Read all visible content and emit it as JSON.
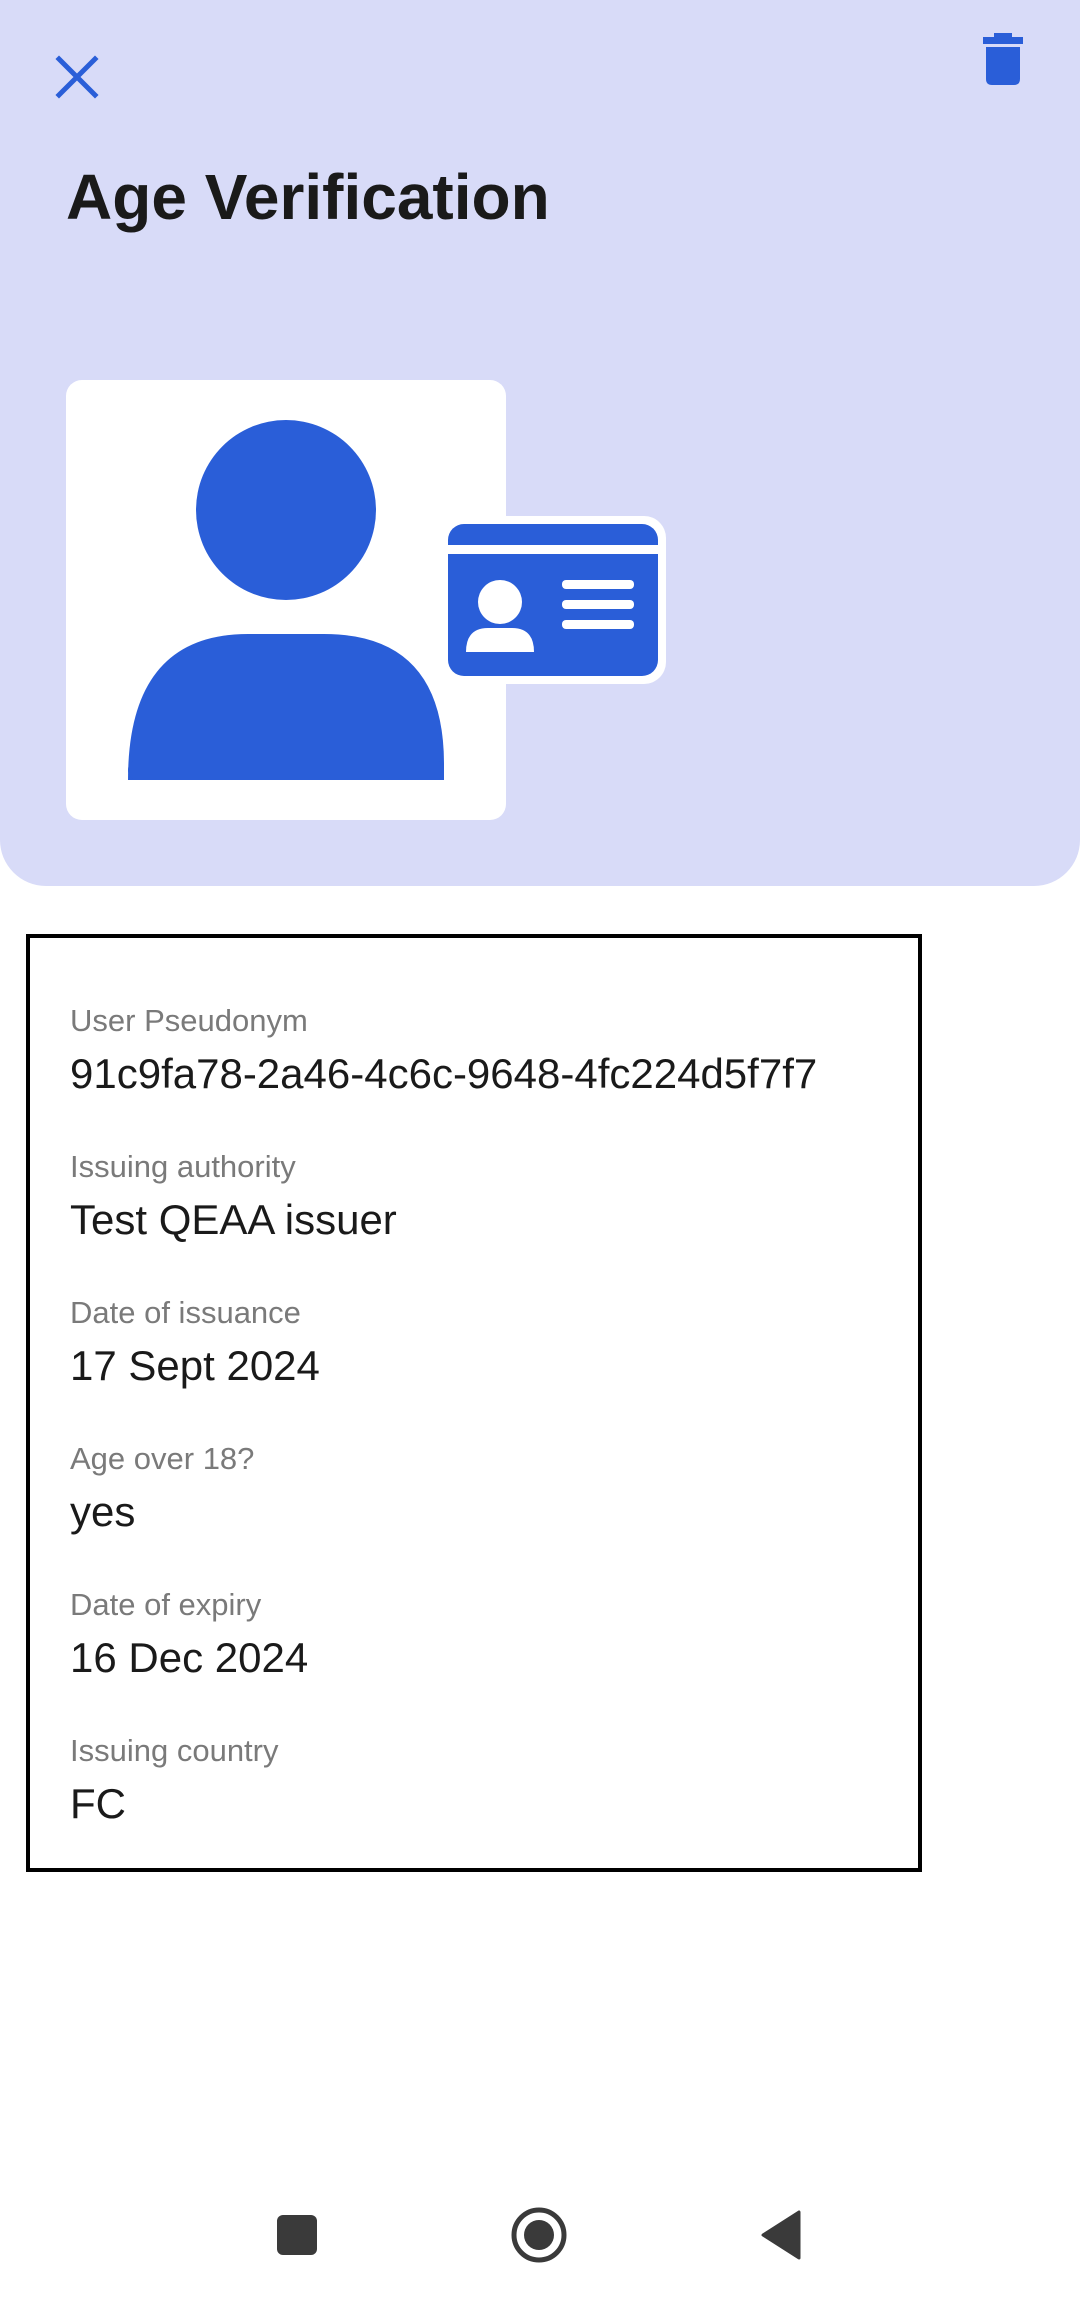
{
  "header": {
    "title": "Age Verification",
    "close_icon": "close-icon",
    "delete_icon": "trash-icon",
    "illustration_icon": "person-id-card-icon",
    "background_color": "#d8dbf8",
    "accent_color": "#2a5ed8"
  },
  "fields": [
    {
      "label": "User Pseudonym",
      "value": "91c9fa78-2a46-4c6c-9648-4fc224d5f7f7"
    },
    {
      "label": "Issuing authority",
      "value": "Test QEAA issuer"
    },
    {
      "label": "Date of issuance",
      "value": "17 Sept 2024"
    },
    {
      "label": "Age over 18?",
      "value": "yes"
    },
    {
      "label": "Date of expiry",
      "value": "16 Dec 2024"
    },
    {
      "label": "Issuing country",
      "value": "FC"
    }
  ],
  "navbar": {
    "recents_icon": "square-icon",
    "home_icon": "circle-icon",
    "back_icon": "back-triangle-icon"
  }
}
